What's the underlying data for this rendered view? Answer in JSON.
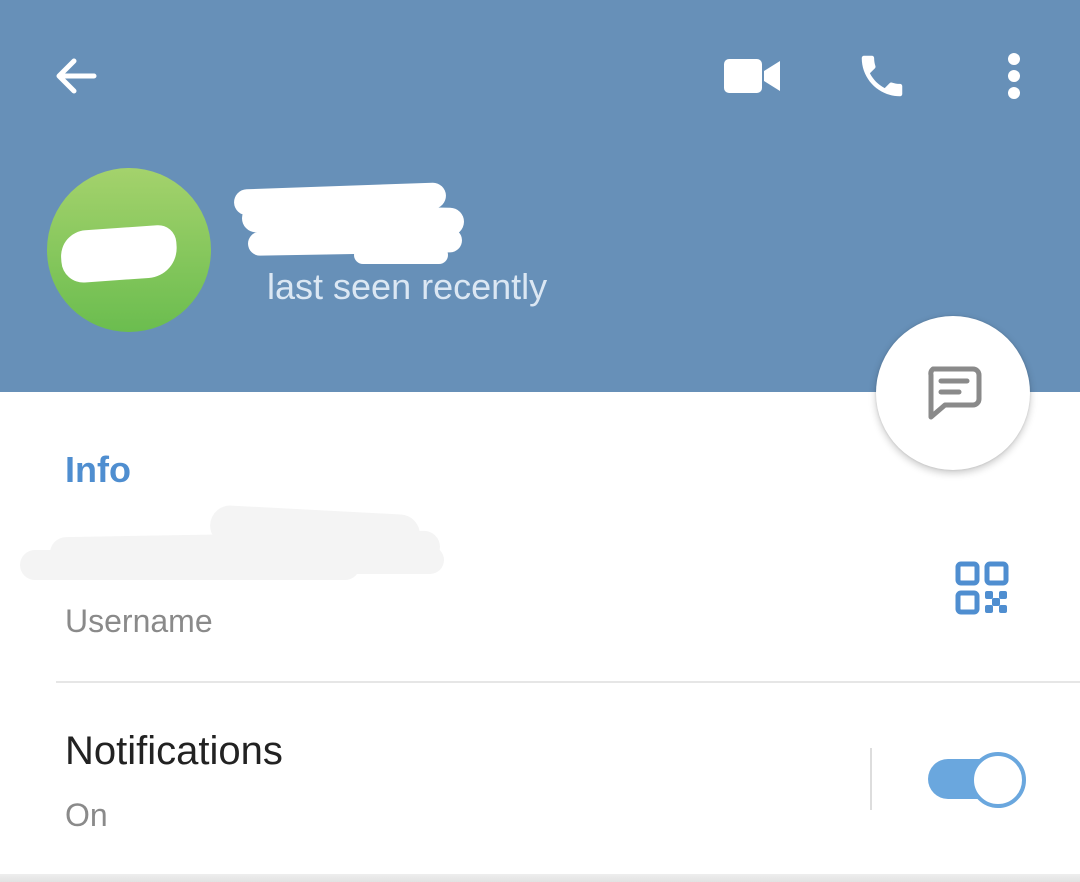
{
  "header": {
    "status": "last seen recently",
    "icons": {
      "back": "arrow-left-icon",
      "video": "video-camera-icon",
      "call": "phone-icon",
      "more": "more-vertical-icon"
    }
  },
  "fab": {
    "icon": "message-icon"
  },
  "info": {
    "section_title": "Info",
    "username_label": "Username",
    "qr_icon": "qr-code-icon"
  },
  "notifications": {
    "title": "Notifications",
    "status": "On",
    "enabled": true
  },
  "colors": {
    "header_bg": "#6790b8",
    "accent": "#4f8ed0",
    "toggle": "#6aa7de",
    "avatar_top": "#a4d26c",
    "avatar_bottom": "#6bbd4f"
  }
}
